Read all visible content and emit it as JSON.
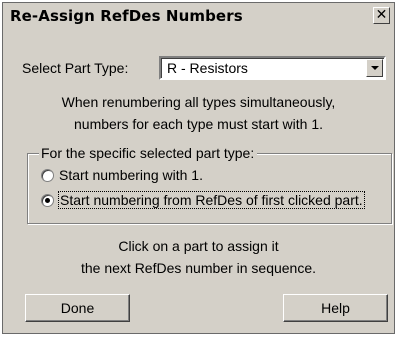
{
  "dialog": {
    "title": "Re-Assign RefDes Numbers",
    "close_glyph": "✕"
  },
  "part_type": {
    "label": "Select Part Type:",
    "selected": "R - Resistors"
  },
  "note": {
    "line1": "When renumbering all types simultaneously,",
    "line2": "numbers for each type must start with 1."
  },
  "group": {
    "legend": "For the specific selected part type:",
    "options": [
      {
        "label": "Start numbering with 1.",
        "checked": false
      },
      {
        "label": "Start numbering from RefDes of first clicked part.",
        "checked": true
      }
    ]
  },
  "instruction": {
    "line1": "Click on a part to assign it",
    "line2": "the next RefDes number in sequence."
  },
  "buttons": {
    "done": "Done",
    "help": "Help"
  }
}
